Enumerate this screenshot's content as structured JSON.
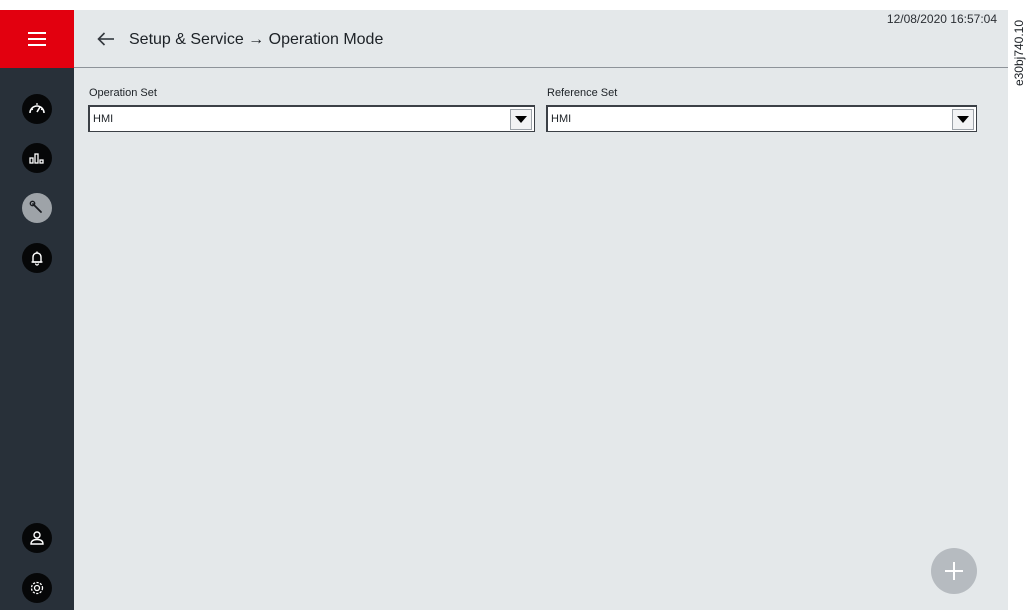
{
  "header": {
    "title": "Setup & Service → Operation Mode",
    "datetime": "12/08/2020 16:57:04"
  },
  "sidebar": {
    "items": [
      {
        "icon": "dashboard-gauge-icon"
      },
      {
        "icon": "trend-chart-icon"
      },
      {
        "icon": "wrench-icon",
        "active": true
      },
      {
        "icon": "bell-icon"
      }
    ],
    "bottom_items": [
      {
        "icon": "user-icon"
      },
      {
        "icon": "settings-icon"
      }
    ]
  },
  "form": {
    "operation_set": {
      "label": "Operation Set",
      "value": "HMI"
    },
    "reference_set": {
      "label": "Reference Set",
      "value": "HMI"
    }
  },
  "figure_id": "e30bj740.10",
  "colors": {
    "menu_bg": "#e2000f",
    "sidebar_bg": "#283039",
    "content_bg": "#e4e8ea",
    "icon_active": "#9ea3a8",
    "add_button": "#b6bbc0"
  }
}
